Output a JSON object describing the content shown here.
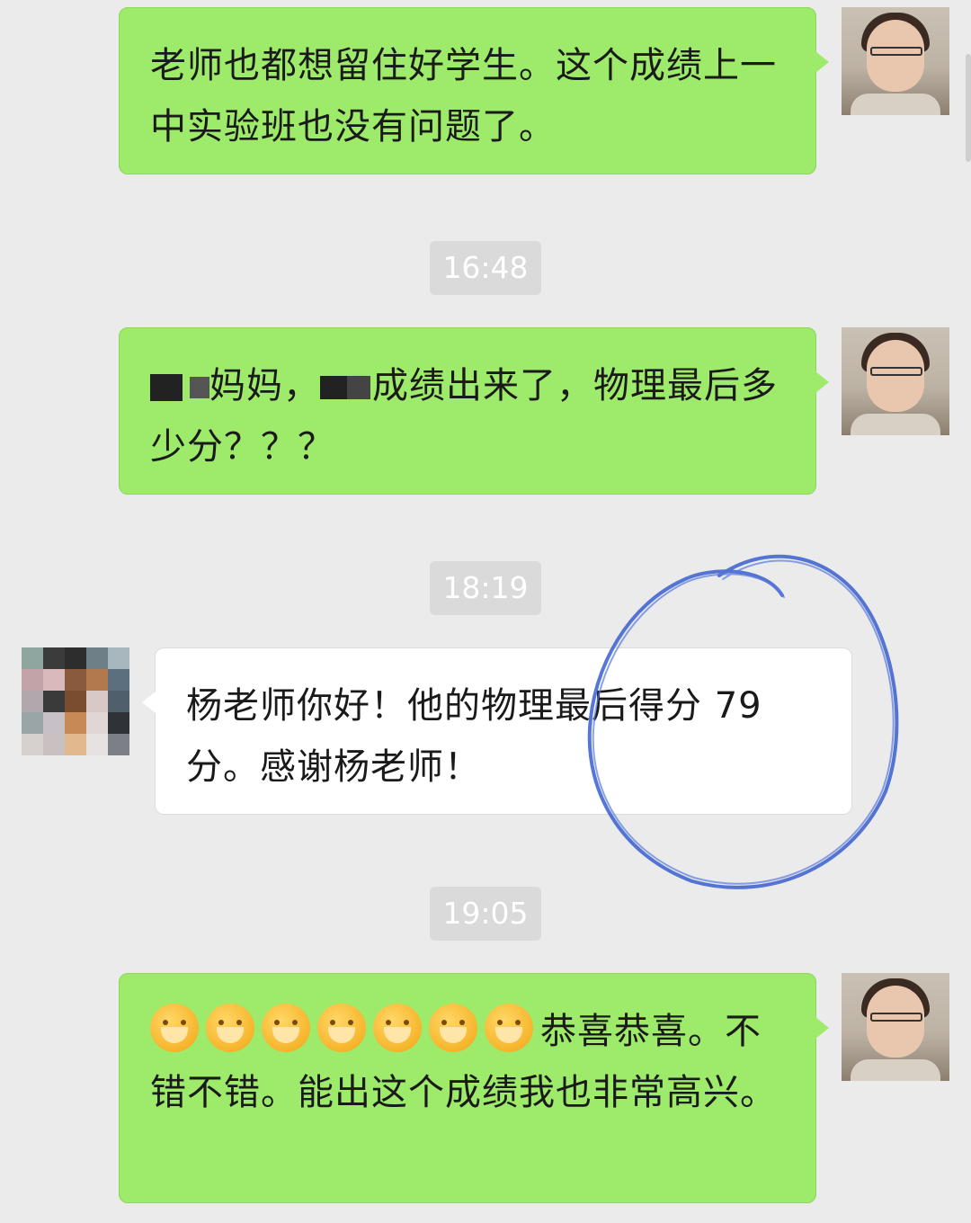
{
  "messages": [
    {
      "sender": "self",
      "text": "老师也都想留住好学生。这个成绩上一中实验班也没有问题了。"
    },
    {
      "sender": "self",
      "text_part1": "妈妈，",
      "text_part2": "成绩出来了，物理最后多少分？？？"
    },
    {
      "sender": "other",
      "text": "杨老师你好！他的物理最后得分 79 分。感谢杨老师！"
    },
    {
      "sender": "self",
      "emoji_count": 7,
      "emoji_icon": "grinning-hand-over-mouth-emoji",
      "text": "恭喜恭喜。不错不错。能出这个成绩我也非常高兴。"
    }
  ],
  "timestamps": [
    "16:48",
    "18:19",
    "19:05"
  ],
  "colors": {
    "background": "#ebebeb",
    "outgoing_bubble": "#9eea6a",
    "incoming_bubble": "#ffffff",
    "timestamp_pill": "#dadada",
    "annotation": "#3a5fd0"
  }
}
